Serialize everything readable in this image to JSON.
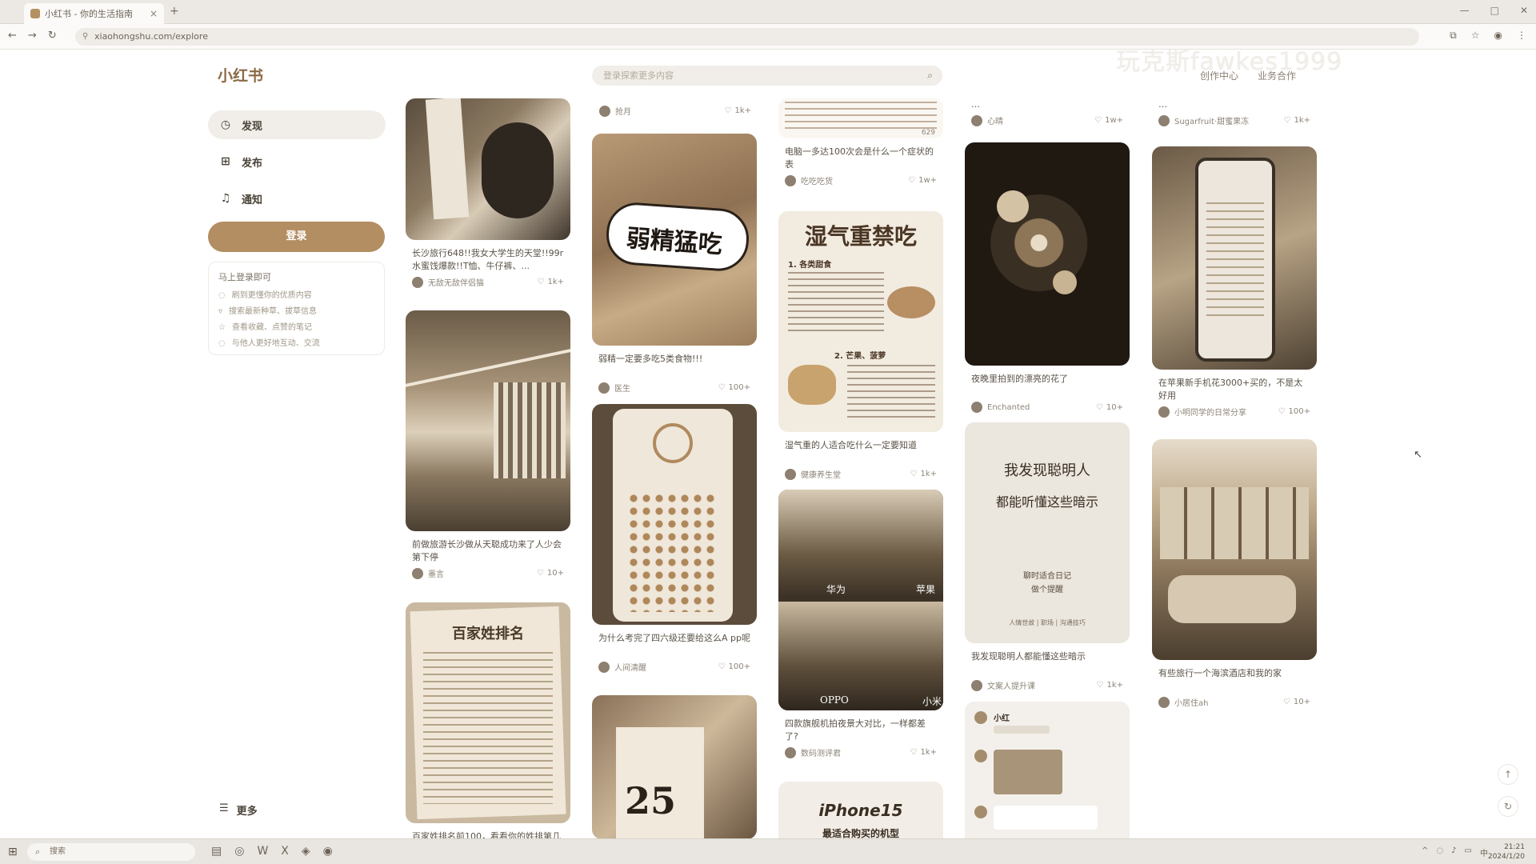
{
  "browser": {
    "tab_title": "小红书 - 你的生活指南",
    "tab_close": "×",
    "new_tab": "+",
    "url": "xiaohongshu.com/explore",
    "watermark": "玩克斯fawkes1999"
  },
  "app": {
    "logo": "小红书",
    "search_placeholder": "登录探索更多内容",
    "top_links": [
      "创作中心",
      "业务合作"
    ]
  },
  "sidebar": {
    "items": [
      {
        "label": "发现",
        "icon": "compass-icon"
      },
      {
        "label": "发布",
        "icon": "plus-square-icon"
      },
      {
        "label": "通知",
        "icon": "bell-icon"
      }
    ],
    "login_button": "登录",
    "login_card_title": "马上登录即可",
    "login_benefits": [
      "刷到更懂你的优质内容",
      "搜索最新种草、拔草信息",
      "查看收藏、点赞的笔记",
      "与他人更好地互动、交流"
    ],
    "more_label": "更多"
  },
  "feed": {
    "col1": [
      {
        "caption": "长沙旅行648!!我女大学生的天堂!!99r水蜜饯爆款!!T恤、牛仔裤、...",
        "author": "无敌无敌伴侣猫",
        "likes": "1k+"
      },
      {
        "caption": "前做旅游长沙做从天聪成功来了人少会第下停",
        "author": "墨言",
        "likes": "10+"
      },
      {
        "caption": "百家姓排名前100，看看你的姓排第几",
        "author": "",
        "likes": "",
        "image_title": "百家姓排名"
      }
    ],
    "col2": [
      {
        "author": "抢月",
        "likes": "1k+"
      },
      {
        "caption": "弱精一定要多吃5类食物!!!",
        "author": "医生",
        "likes": "100+",
        "image_text": "弱精猛吃"
      },
      {
        "caption": "为什么考完了四六级还要给这么A pp呢",
        "author": "人间清醒",
        "likes": "100+"
      },
      {
        "image_text": "25"
      }
    ],
    "col3": [
      {
        "caption": "电脑一多达100次会是什么一个症状的表",
        "author": "吃吃吃货",
        "likes": "1w+",
        "likes_top": "629"
      },
      {
        "caption": "湿气重的人适合吃什么一定要知道",
        "author": "健康养生堂",
        "likes": "1k+",
        "image_title": "湿气重禁吃",
        "image_sub1": "1. 各类甜食",
        "image_sub2": "2. 芒果、菠萝"
      },
      {
        "caption": "四款旗舰机拍夜景大对比，一样都差了?",
        "author": "数码测评君",
        "likes": "1k+",
        "image_labels": [
          "华为",
          "苹果",
          "OPPO",
          "小米"
        ]
      },
      {
        "image_text": "iPhone15",
        "image_sub": "最适合购买的机型"
      }
    ],
    "col4": [
      {
        "author": "心晴",
        "likes": "1w+"
      },
      {
        "caption": "夜晚里拍到的漂亮的花了",
        "author": "Enchanted",
        "likes": "10+"
      },
      {
        "caption": "我发现聪明人都能懂这些暗示",
        "author": "文案人提升课",
        "likes": "1k+",
        "image_line1": "我发现聪明人",
        "image_line2": "都能听懂这些暗示",
        "image_line3": "聊时适合日记",
        "image_line4": "做个提醒",
        "image_footer": "人情世故 | 职场 | 沟通技巧"
      },
      {
        "chat_name": "小红"
      }
    ],
    "col5": [
      {
        "author": "Sugarfruit·甜蜜果冻",
        "likes": "1k+"
      },
      {
        "caption": "在苹果新手机花3000+买的，不是太好用",
        "author": "小明同学的日常分享",
        "likes": "100+"
      },
      {
        "caption": "有些旅行一个海滨酒店和我的家",
        "author": "小居住ah",
        "likes": "10+"
      }
    ]
  },
  "taskbar": {
    "search_label": "搜索",
    "time": "21:21",
    "date": "2024/1/20"
  },
  "colors": {
    "accent": "#b28e62",
    "text": "#4a4338",
    "muted": "#8d8477"
  }
}
